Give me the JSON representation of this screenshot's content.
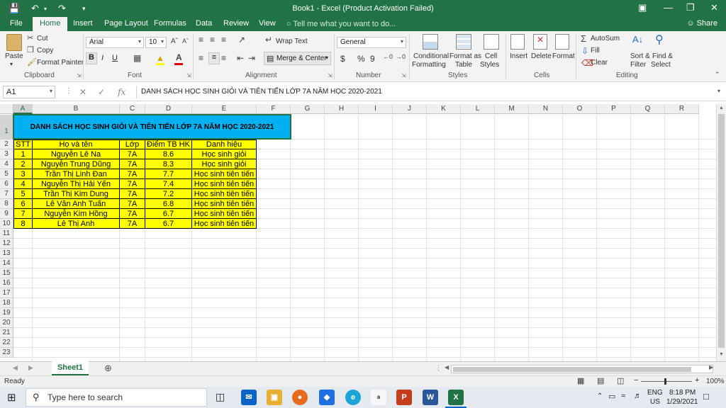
{
  "titlebar": {
    "title": "Book1 - Excel (Product Activation Failed)",
    "minimize_icon": "minimize-icon",
    "restore_icon": "restore-icon",
    "close_icon": "close-icon"
  },
  "ribbon_tabs": [
    "File",
    "Home",
    "Insert",
    "Page Layout",
    "Formulas",
    "Data",
    "Review",
    "View"
  ],
  "tell_me": "Tell me what you want to do...",
  "share": "Share",
  "clipboard": {
    "paste": "Paste",
    "cut": "Cut",
    "copy": "Copy",
    "format_painter": "Format Painter",
    "label": "Clipboard"
  },
  "font": {
    "name": "Arial",
    "size": "10",
    "bold": "B",
    "italic": "I",
    "underline": "U",
    "label": "Font"
  },
  "alignment": {
    "wrap_text": "Wrap Text",
    "merge_center": "Merge & Center",
    "label": "Alignment"
  },
  "number": {
    "format": "General",
    "currency": "$",
    "percent": "%",
    "comma": "9",
    "label": "Number"
  },
  "styles": {
    "conditional_1": "Conditional",
    "conditional_2": "Formatting",
    "format_table_1": "Format as",
    "format_table_2": "Table",
    "cell_styles_1": "Cell",
    "cell_styles_2": "Styles",
    "label": "Styles"
  },
  "cells": {
    "insert": "Insert",
    "delete": "Delete",
    "format": "Format",
    "label": "Cells"
  },
  "editing": {
    "autosum": "AutoSum",
    "fill": "Fill",
    "clear": "Clear",
    "sort_1": "Sort &",
    "sort_2": "Filter",
    "find_1": "Find &",
    "find_2": "Select",
    "label": "Editing"
  },
  "formula_bar": {
    "name_box": "A1",
    "fx": "fx",
    "content": "DANH SÁCH HỌC SINH GIỎI VÀ TIÊN TIẾN LỚP 7A NĂM HỌC 2020-2021"
  },
  "grid": {
    "columns": [
      "A",
      "B",
      "C",
      "D",
      "E",
      "F",
      "G",
      "H",
      "I",
      "J",
      "K",
      "L",
      "M",
      "N",
      "O",
      "P",
      "Q",
      "R"
    ],
    "rows": [
      "1",
      "2",
      "3",
      "4",
      "5",
      "6",
      "7",
      "8",
      "9",
      "10",
      "11",
      "12",
      "13",
      "14",
      "15",
      "16",
      "17",
      "18",
      "19",
      "20",
      "21",
      "22",
      "23"
    ]
  },
  "table": {
    "title": "DANH SÁCH HỌC SINH GIỎI VÀ TIÊN TIẾN LỚP 7A NĂM HỌC 2020-2021",
    "headers": [
      "STT",
      "Họ và tên",
      "Lớp",
      "Điểm TB HK",
      "Danh hiệu"
    ],
    "rows": [
      [
        "1",
        "Nguyễn Lê Na",
        "7A",
        "8.6",
        "Học sinh giỏi"
      ],
      [
        "2",
        "Nguyễn Trung Dũng",
        "7A",
        "8.3",
        "Học sinh giỏi"
      ],
      [
        "3",
        "Trần Thị Linh Đan",
        "7A",
        "7.7",
        "Học sinh tiên tiến"
      ],
      [
        "4",
        "Nguyễn Thị Hải Yến",
        "7A",
        "7.4",
        "Học sinh tiên tiến"
      ],
      [
        "5",
        "Trần Thị Kim Dung",
        "7A",
        "7.2",
        "Học sinh tiên tiến"
      ],
      [
        "6",
        "Lê Văn Anh Tuấn",
        "7A",
        "6.8",
        "Học sinh tiên tiến"
      ],
      [
        "7",
        "Nguyễn Kim Hồng",
        "7A",
        "6.7",
        "Học sinh tiên tiến"
      ],
      [
        "8",
        "Lê Thị Anh",
        "7A",
        "6.7",
        "Học sinh tiên tiến"
      ]
    ]
  },
  "sheets": [
    "Sheet1"
  ],
  "status": {
    "ready": "Ready",
    "zoom": "100%"
  },
  "taskbar": {
    "search_placeholder": "Type here to search",
    "lang_1": "ENG",
    "lang_2": "US",
    "time": "8:18 PM",
    "date": "1/29/2021"
  },
  "colors": {
    "excel_green": "#217346",
    "title_fill": "#00b0f0",
    "table_fill": "#ffff00"
  }
}
